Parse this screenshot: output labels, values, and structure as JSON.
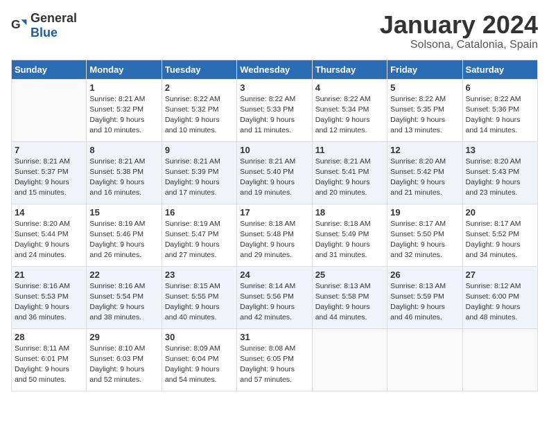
{
  "logo": {
    "text_general": "General",
    "text_blue": "Blue"
  },
  "title": "January 2024",
  "subtitle": "Solsona, Catalonia, Spain",
  "days_of_week": [
    "Sunday",
    "Monday",
    "Tuesday",
    "Wednesday",
    "Thursday",
    "Friday",
    "Saturday"
  ],
  "weeks": [
    [
      {
        "day": "",
        "info": ""
      },
      {
        "day": "1",
        "info": "Sunrise: 8:21 AM\nSunset: 5:32 PM\nDaylight: 9 hours\nand 10 minutes."
      },
      {
        "day": "2",
        "info": "Sunrise: 8:22 AM\nSunset: 5:32 PM\nDaylight: 9 hours\nand 10 minutes."
      },
      {
        "day": "3",
        "info": "Sunrise: 8:22 AM\nSunset: 5:33 PM\nDaylight: 9 hours\nand 11 minutes."
      },
      {
        "day": "4",
        "info": "Sunrise: 8:22 AM\nSunset: 5:34 PM\nDaylight: 9 hours\nand 12 minutes."
      },
      {
        "day": "5",
        "info": "Sunrise: 8:22 AM\nSunset: 5:35 PM\nDaylight: 9 hours\nand 13 minutes."
      },
      {
        "day": "6",
        "info": "Sunrise: 8:22 AM\nSunset: 5:36 PM\nDaylight: 9 hours\nand 14 minutes."
      }
    ],
    [
      {
        "day": "7",
        "info": "Sunrise: 8:21 AM\nSunset: 5:37 PM\nDaylight: 9 hours\nand 15 minutes."
      },
      {
        "day": "8",
        "info": "Sunrise: 8:21 AM\nSunset: 5:38 PM\nDaylight: 9 hours\nand 16 minutes."
      },
      {
        "day": "9",
        "info": "Sunrise: 8:21 AM\nSunset: 5:39 PM\nDaylight: 9 hours\nand 17 minutes."
      },
      {
        "day": "10",
        "info": "Sunrise: 8:21 AM\nSunset: 5:40 PM\nDaylight: 9 hours\nand 19 minutes."
      },
      {
        "day": "11",
        "info": "Sunrise: 8:21 AM\nSunset: 5:41 PM\nDaylight: 9 hours\nand 20 minutes."
      },
      {
        "day": "12",
        "info": "Sunrise: 8:20 AM\nSunset: 5:42 PM\nDaylight: 9 hours\nand 21 minutes."
      },
      {
        "day": "13",
        "info": "Sunrise: 8:20 AM\nSunset: 5:43 PM\nDaylight: 9 hours\nand 23 minutes."
      }
    ],
    [
      {
        "day": "14",
        "info": "Sunrise: 8:20 AM\nSunset: 5:44 PM\nDaylight: 9 hours\nand 24 minutes."
      },
      {
        "day": "15",
        "info": "Sunrise: 8:19 AM\nSunset: 5:46 PM\nDaylight: 9 hours\nand 26 minutes."
      },
      {
        "day": "16",
        "info": "Sunrise: 8:19 AM\nSunset: 5:47 PM\nDaylight: 9 hours\nand 27 minutes."
      },
      {
        "day": "17",
        "info": "Sunrise: 8:18 AM\nSunset: 5:48 PM\nDaylight: 9 hours\nand 29 minutes."
      },
      {
        "day": "18",
        "info": "Sunrise: 8:18 AM\nSunset: 5:49 PM\nDaylight: 9 hours\nand 31 minutes."
      },
      {
        "day": "19",
        "info": "Sunrise: 8:17 AM\nSunset: 5:50 PM\nDaylight: 9 hours\nand 32 minutes."
      },
      {
        "day": "20",
        "info": "Sunrise: 8:17 AM\nSunset: 5:52 PM\nDaylight: 9 hours\nand 34 minutes."
      }
    ],
    [
      {
        "day": "21",
        "info": "Sunrise: 8:16 AM\nSunset: 5:53 PM\nDaylight: 9 hours\nand 36 minutes."
      },
      {
        "day": "22",
        "info": "Sunrise: 8:16 AM\nSunset: 5:54 PM\nDaylight: 9 hours\nand 38 minutes."
      },
      {
        "day": "23",
        "info": "Sunrise: 8:15 AM\nSunset: 5:55 PM\nDaylight: 9 hours\nand 40 minutes."
      },
      {
        "day": "24",
        "info": "Sunrise: 8:14 AM\nSunset: 5:56 PM\nDaylight: 9 hours\nand 42 minutes."
      },
      {
        "day": "25",
        "info": "Sunrise: 8:13 AM\nSunset: 5:58 PM\nDaylight: 9 hours\nand 44 minutes."
      },
      {
        "day": "26",
        "info": "Sunrise: 8:13 AM\nSunset: 5:59 PM\nDaylight: 9 hours\nand 46 minutes."
      },
      {
        "day": "27",
        "info": "Sunrise: 8:12 AM\nSunset: 6:00 PM\nDaylight: 9 hours\nand 48 minutes."
      }
    ],
    [
      {
        "day": "28",
        "info": "Sunrise: 8:11 AM\nSunset: 6:01 PM\nDaylight: 9 hours\nand 50 minutes."
      },
      {
        "day": "29",
        "info": "Sunrise: 8:10 AM\nSunset: 6:03 PM\nDaylight: 9 hours\nand 52 minutes."
      },
      {
        "day": "30",
        "info": "Sunrise: 8:09 AM\nSunset: 6:04 PM\nDaylight: 9 hours\nand 54 minutes."
      },
      {
        "day": "31",
        "info": "Sunrise: 8:08 AM\nSunset: 6:05 PM\nDaylight: 9 hours\nand 57 minutes."
      },
      {
        "day": "",
        "info": ""
      },
      {
        "day": "",
        "info": ""
      },
      {
        "day": "",
        "info": ""
      }
    ]
  ]
}
